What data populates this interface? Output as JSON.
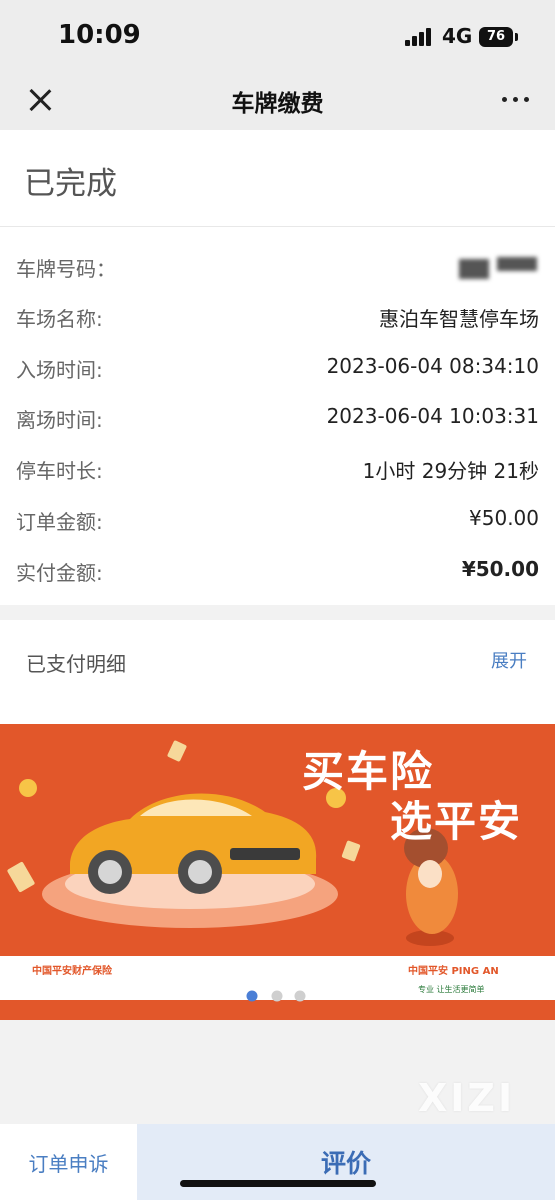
{
  "status_bar": {
    "time": "10:09",
    "network": "4G",
    "battery": "76"
  },
  "nav": {
    "title": "车牌缴费",
    "close_icon": "close-icon",
    "more_icon": "more-icon"
  },
  "order": {
    "status": "已完成"
  },
  "details": [
    {
      "label": "车牌号码：",
      "value": ""
    },
    {
      "label": "车场名称:",
      "value": "惠泊车智慧停车场"
    },
    {
      "label": "入场时间:",
      "value": "2023-06-04 08:34:10"
    },
    {
      "label": "离场时间:",
      "value": "2023-06-04 10:03:31"
    },
    {
      "label": "停车时长:",
      "value": "1小时 29分钟 21秒"
    },
    {
      "label": "订单金额:",
      "value": "¥50.00"
    },
    {
      "label": "实付金额:",
      "value": "¥50.00"
    }
  ],
  "paid_detail": {
    "label": "已支付明细",
    "expand": "展开"
  },
  "ad": {
    "headline_1": "买车险",
    "headline_2": "选平安",
    "brand_left": "中国平安财产保险",
    "brand_right": "中国平安 PING AN",
    "slogan": "专业 让生活更简单",
    "background_color": "#e2572a",
    "carousel_pages": 3,
    "active_page": 1
  },
  "watermark": "XIZI",
  "bottom": {
    "appeal": "订单申诉",
    "rate": "评价"
  },
  "colors": {
    "accent": "#4a7ec2",
    "rate_bg": "#e3ebf7",
    "page_bg": "#f2f2f2"
  }
}
